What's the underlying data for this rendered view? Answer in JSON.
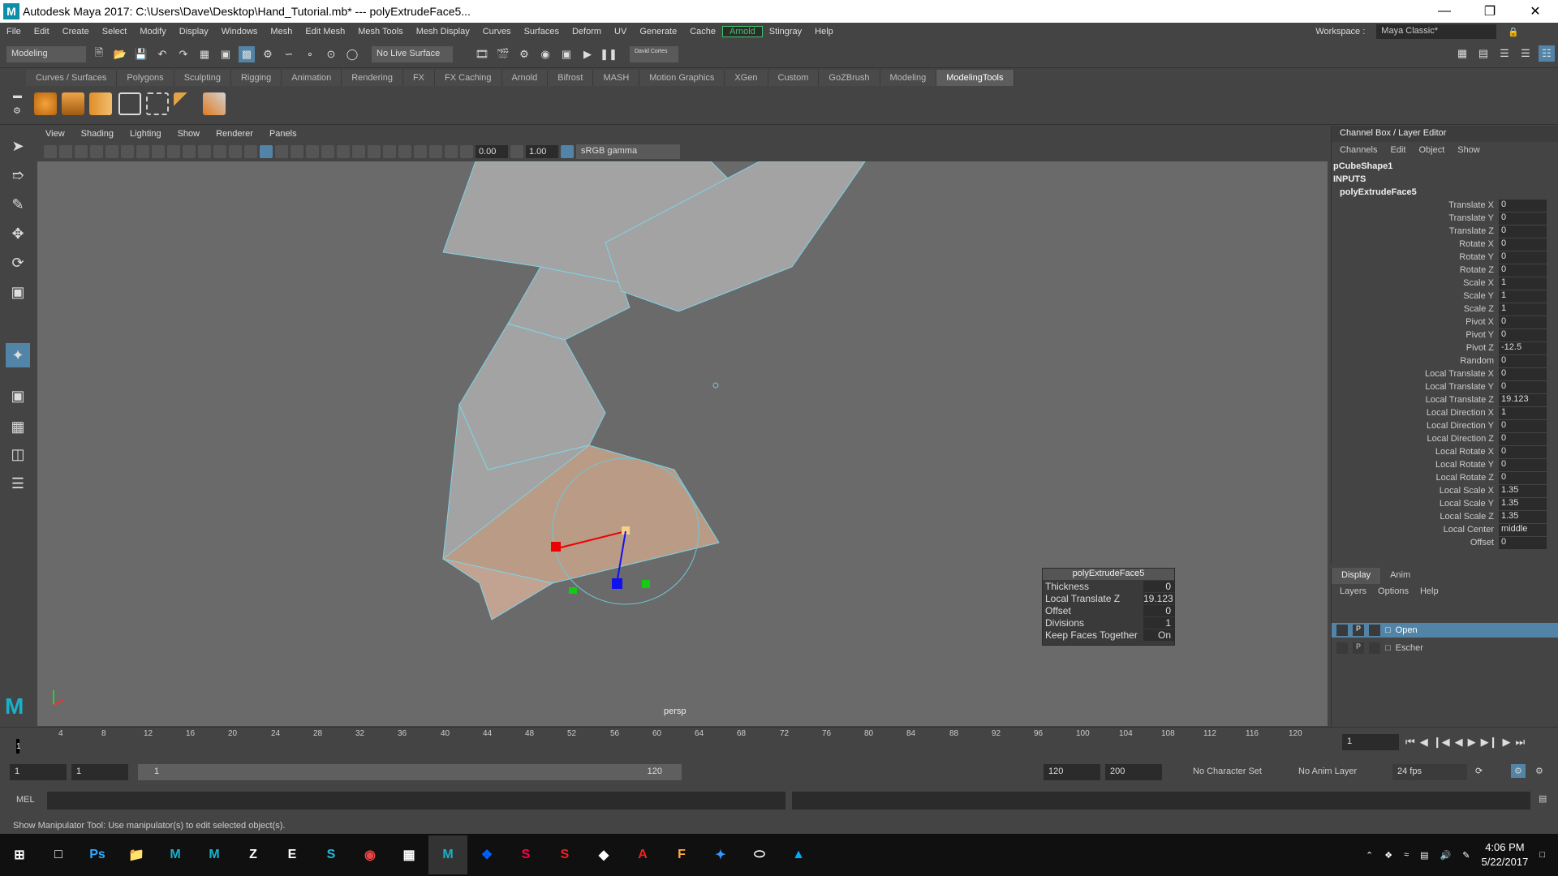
{
  "window": {
    "title": "Autodesk Maya 2017: C:\\Users\\Dave\\Desktop\\Hand_Tutorial.mb*   ---   polyExtrudeFace5...",
    "logo_letter": "M"
  },
  "menubar": {
    "items": [
      "File",
      "Edit",
      "Create",
      "Select",
      "Modify",
      "Display",
      "Windows",
      "Mesh",
      "Edit Mesh",
      "Mesh Tools",
      "Mesh Display",
      "Curves",
      "Surfaces",
      "Deform",
      "UV",
      "Generate",
      "Cache",
      "Arnold",
      "Stingray",
      "Help"
    ],
    "workspace_label": "Workspace :",
    "workspace_value": "Maya Classic*"
  },
  "statusline": {
    "mode": "Modeling",
    "live_surface": "No Live Surface",
    "user": "David Cortes"
  },
  "shelf": {
    "tabs": [
      "Curves / Surfaces",
      "Polygons",
      "Sculpting",
      "Rigging",
      "Animation",
      "Rendering",
      "FX",
      "FX Caching",
      "Arnold",
      "Bifrost",
      "MASH",
      "Motion Graphics",
      "XGen",
      "Custom",
      "GoZBrush",
      "Modeling",
      "ModelingTools"
    ]
  },
  "viewport": {
    "menu": [
      "View",
      "Shading",
      "Lighting",
      "Show",
      "Renderer",
      "Panels"
    ],
    "exposure": "0.00",
    "gamma": "1.00",
    "colorspace": "sRGB gamma",
    "camera": "persp"
  },
  "popup": {
    "title": "polyExtrudeFace5",
    "rows": [
      {
        "k": "Thickness",
        "v": "0"
      },
      {
        "k": "Local Translate Z",
        "v": "19.123"
      },
      {
        "k": "Offset",
        "v": "0"
      },
      {
        "k": "Divisions",
        "v": "1"
      },
      {
        "k": "Keep Faces Together",
        "v": "On"
      }
    ]
  },
  "channelbox": {
    "title": "Channel Box / Layer Editor",
    "menu": [
      "Channels",
      "Edit",
      "Object",
      "Show"
    ],
    "shape": "pCubeShape1",
    "inputs": "INPUTS",
    "node": "polyExtrudeFace5",
    "attrs": [
      {
        "k": "Translate X",
        "v": "0"
      },
      {
        "k": "Translate Y",
        "v": "0"
      },
      {
        "k": "Translate Z",
        "v": "0"
      },
      {
        "k": "Rotate X",
        "v": "0"
      },
      {
        "k": "Rotate Y",
        "v": "0"
      },
      {
        "k": "Rotate Z",
        "v": "0"
      },
      {
        "k": "Scale X",
        "v": "1"
      },
      {
        "k": "Scale Y",
        "v": "1"
      },
      {
        "k": "Scale Z",
        "v": "1"
      },
      {
        "k": "Pivot X",
        "v": "0"
      },
      {
        "k": "Pivot Y",
        "v": "0"
      },
      {
        "k": "Pivot Z",
        "v": "-12.5"
      },
      {
        "k": "Random",
        "v": "0"
      },
      {
        "k": "Local Translate X",
        "v": "0"
      },
      {
        "k": "Local Translate Y",
        "v": "0"
      },
      {
        "k": "Local Translate Z",
        "v": "19.123"
      },
      {
        "k": "Local Direction X",
        "v": "1"
      },
      {
        "k": "Local Direction Y",
        "v": "0"
      },
      {
        "k": "Local Direction Z",
        "v": "0"
      },
      {
        "k": "Local Rotate X",
        "v": "0"
      },
      {
        "k": "Local Rotate Y",
        "v": "0"
      },
      {
        "k": "Local Rotate Z",
        "v": "0"
      },
      {
        "k": "Local Scale X",
        "v": "1.35"
      },
      {
        "k": "Local Scale Y",
        "v": "1.35"
      },
      {
        "k": "Local Scale Z",
        "v": "1.35"
      },
      {
        "k": "Local Center",
        "v": "middle"
      },
      {
        "k": "Offset",
        "v": "0"
      }
    ]
  },
  "layers": {
    "tabs": [
      "Display",
      "Anim"
    ],
    "menu": [
      "Layers",
      "Options",
      "Help"
    ],
    "items": [
      {
        "flag": "P",
        "name": "Open"
      },
      {
        "flag": "P",
        "name": "Escher"
      }
    ]
  },
  "timeline": {
    "ticks": [
      "4",
      "8",
      "12",
      "16",
      "20",
      "24",
      "28",
      "32",
      "36",
      "40",
      "44",
      "48",
      "52",
      "56",
      "60",
      "64",
      "68",
      "72",
      "76",
      "80",
      "84",
      "88",
      "92",
      "96",
      "100",
      "104",
      "108",
      "112",
      "116",
      "120"
    ],
    "current_frame": "1",
    "frame_label": "1"
  },
  "range": {
    "start": "1",
    "start2": "1",
    "slider_start": "1",
    "slider_end": "120",
    "end": "120",
    "end2": "200",
    "character_set": "No Character Set",
    "anim_layer": "No Anim Layer",
    "fps": "24 fps"
  },
  "mel": {
    "label": "MEL"
  },
  "help": {
    "text": "Show Manipulator Tool: Use manipulator(s) to edit selected object(s)."
  },
  "taskbar": {
    "time": "4:06 PM",
    "date": "5/22/2017"
  }
}
